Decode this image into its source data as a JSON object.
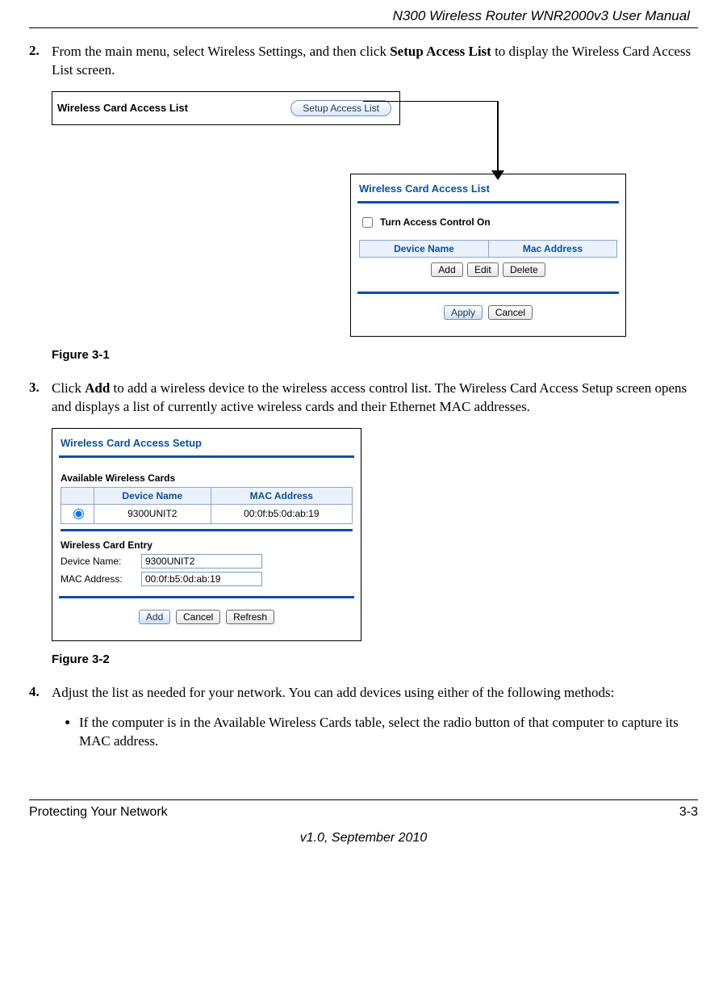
{
  "header_title": "N300 Wireless Router WNR2000v3 User Manual",
  "step2": {
    "num": "2.",
    "text_before": "From the main menu, select Wireless Settings, and then click ",
    "bold1": "Setup Access List",
    "text_after": " to display the Wireless Card Access List screen."
  },
  "fig1": {
    "top_label": "Wireless Card Access List",
    "setup_btn": "Setup Access List",
    "dialog_title": "Wireless Card Access List",
    "turn_on": "Turn Access Control On",
    "th_dev": "Device Name",
    "th_mac": "Mac Address",
    "btn_add": "Add",
    "btn_edit": "Edit",
    "btn_delete": "Delete",
    "btn_apply": "Apply",
    "btn_cancel": "Cancel",
    "caption": "Figure 3-1"
  },
  "step3": {
    "num": "3.",
    "text_before": "Click ",
    "bold1": "Add",
    "text_after": " to add a wireless device to the wireless access control list. The Wireless Card Access Setup screen opens and displays a list of currently active wireless cards and their Ethernet MAC addresses."
  },
  "fig2": {
    "dialog_title": "Wireless Card Access Setup",
    "avail_hdr": "Available Wireless Cards",
    "th_dev": "Device Name",
    "th_mac": "MAC Address",
    "row_dev": "9300UNIT2",
    "row_mac": "00:0f:b5:0d:ab:19",
    "entry_hdr": "Wireless Card Entry",
    "lbl_dev": "Device Name:",
    "lbl_mac": "MAC Address:",
    "val_dev": "9300UNIT2",
    "val_mac": "00:0f:b5:0d:ab:19",
    "btn_add": "Add",
    "btn_cancel": "Cancel",
    "btn_refresh": "Refresh",
    "caption": "Figure 3-2"
  },
  "step4": {
    "num": "4.",
    "text": "Adjust the list as needed for your network. You can add devices using either of the following methods:",
    "bullet1": "If the computer is in the Available Wireless Cards table, select the radio button of that computer to capture its MAC address."
  },
  "footer": {
    "left": "Protecting Your Network",
    "right": "3-3",
    "center": "v1.0, September 2010"
  }
}
